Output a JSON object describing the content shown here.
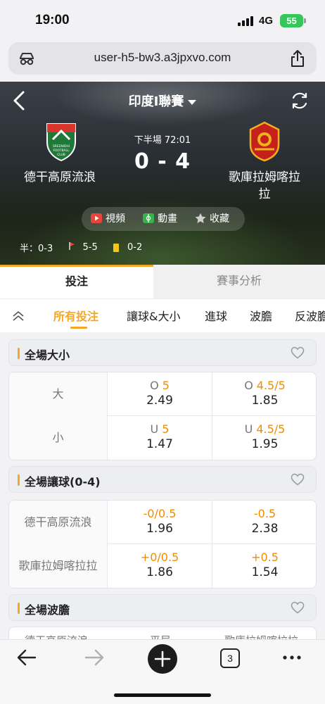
{
  "status_bar": {
    "time": "19:00",
    "network": "4G",
    "battery": "55"
  },
  "browser": {
    "url": "user-h5-bw3.a3jpxvo.com",
    "tab_count": "3"
  },
  "match": {
    "league": "印度I聯賽",
    "period": "下半場",
    "clock": "72:01",
    "score": "0 - 4",
    "home_team": "德干高原流浪",
    "away_team": "歌庫拉姆喀拉拉",
    "home_crest_text": [
      "SREENIDHI",
      "FOOTBALL",
      "CLUB"
    ],
    "away_crest_text": "GOKULAM KERALA FC",
    "actions": {
      "video": "視頻",
      "animation": "動畫",
      "favorite": "收藏"
    },
    "stats": {
      "half_time": "半：0-3",
      "corners": "5-5",
      "yellow_cards": "0-2"
    }
  },
  "tabs": {
    "bet": "投注",
    "analysis": "賽事分析"
  },
  "filters": [
    "所有投注",
    "讓球&大小",
    "進球",
    "波膽",
    "反波膽"
  ],
  "markets": [
    {
      "title": "全場大小",
      "rows": [
        {
          "label": "大",
          "opts": [
            {
              "prefix": "O",
              "line": "5",
              "odds": "2.49"
            },
            {
              "prefix": "O",
              "line": "4.5/5",
              "odds": "1.85"
            }
          ]
        },
        {
          "label": "小",
          "opts": [
            {
              "prefix": "U",
              "line": "5",
              "odds": "1.47"
            },
            {
              "prefix": "U",
              "line": "4.5/5",
              "odds": "1.95"
            }
          ]
        }
      ]
    },
    {
      "title": "全場讓球(0-4)",
      "rows": [
        {
          "label": "德干高原流浪",
          "opts": [
            {
              "prefix": "",
              "line": "-0/0.5",
              "odds": "1.96"
            },
            {
              "prefix": "",
              "line": "-0.5",
              "odds": "2.38"
            }
          ]
        },
        {
          "label": "歌庫拉姆喀拉拉",
          "opts": [
            {
              "prefix": "",
              "line": "+0/0.5",
              "odds": "1.86"
            },
            {
              "prefix": "",
              "line": "+0.5",
              "odds": "1.54"
            }
          ]
        }
      ]
    },
    {
      "title": "全場波膽",
      "columns": [
        "德干高原流浪",
        "平局",
        "歌庫拉姆喀拉拉"
      ]
    }
  ],
  "colors": {
    "accent": "#f5a623",
    "handicap": "#f08c00",
    "battery": "#35c759"
  }
}
